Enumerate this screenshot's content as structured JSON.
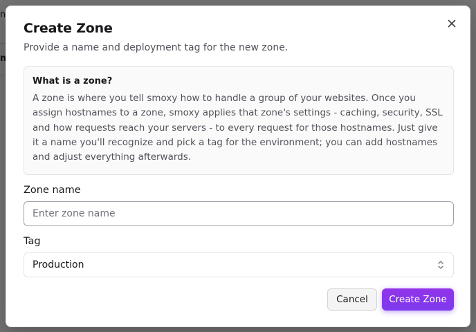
{
  "background_page": {
    "row1_text": "ne",
    "row2_text": "m"
  },
  "dialog": {
    "title": "Create Zone",
    "description": "Provide a name and deployment tag for the new zone.",
    "close_icon": "close-icon",
    "info": {
      "title": "What is a zone?",
      "text": "A zone is where you tell smoxy how to handle a group of your websites. Once you assign hostnames to a zone, smoxy applies that zone's settings - caching, security, SSL and how requests reach your servers - to every request for those hostnames. Just give it a name you'll recognize and pick a tag for the environment; you can add hostnames and adjust everything afterwards."
    },
    "zone_name": {
      "label": "Zone name",
      "placeholder": "Enter zone name",
      "value": ""
    },
    "tag": {
      "label": "Tag",
      "selected": "Production",
      "icon": "chevrons-up-down-icon"
    },
    "buttons": {
      "cancel": "Cancel",
      "create": "Create Zone"
    }
  },
  "colors": {
    "primary": "#7c3aed",
    "primary_light": "#9333ea",
    "overlay": "#000000",
    "muted_text": "#52525b"
  }
}
